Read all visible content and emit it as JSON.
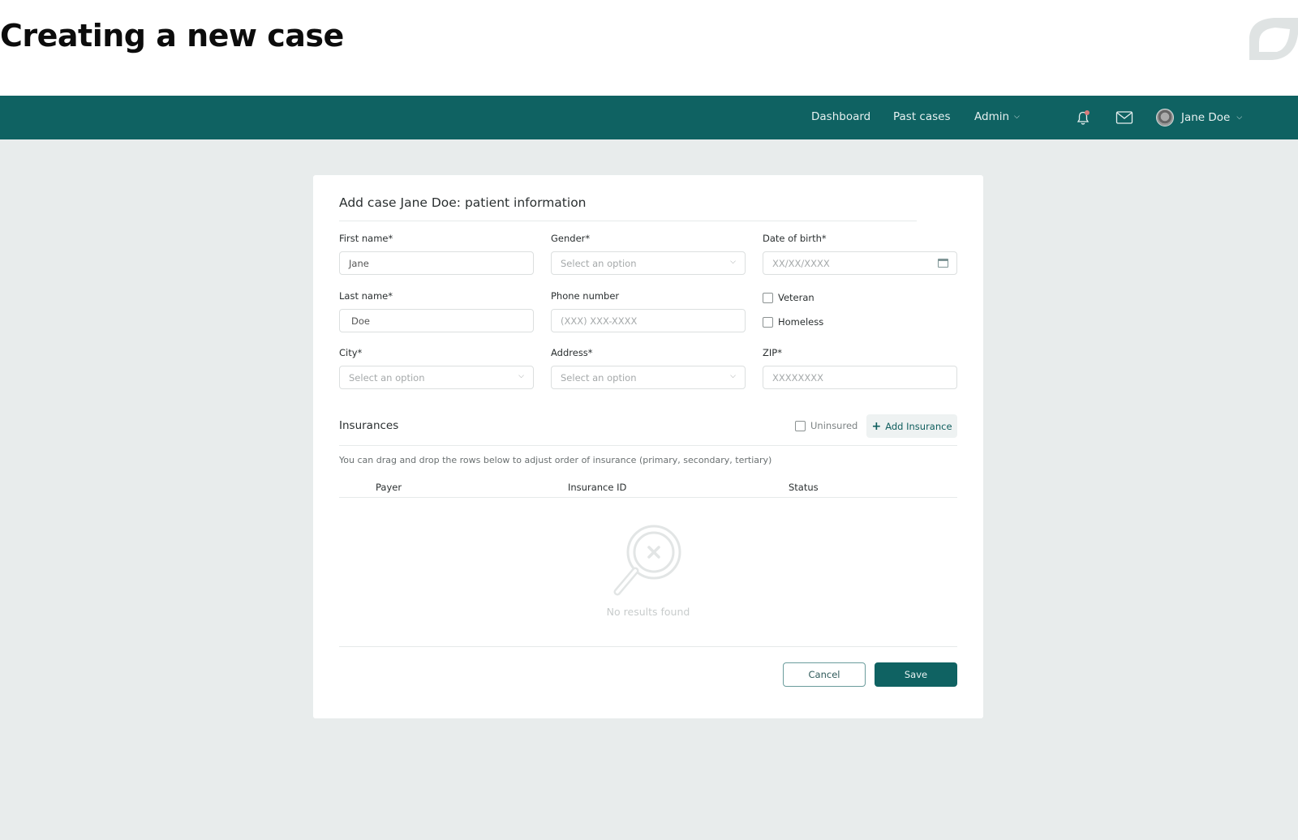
{
  "page": {
    "title": "Creating a new case"
  },
  "navbar": {
    "links": [
      {
        "label": "Dashboard"
      },
      {
        "label": "Past cases"
      },
      {
        "label": "Admin",
        "has_dropdown": true
      }
    ],
    "icons": {
      "notifications": "bell-icon",
      "messages": "mail-icon"
    },
    "user": {
      "name": "Jane Doe",
      "has_dropdown": true
    },
    "colors": {
      "bar": "#0f6262",
      "notification_dot": "#d97c7c"
    }
  },
  "form": {
    "title": "Add case Jane Doe: patient information",
    "fields": {
      "first_name": {
        "label": "First name*",
        "value": "Jane"
      },
      "gender": {
        "label": "Gender*",
        "placeholder": "Select an option"
      },
      "dob": {
        "label": "Date of birth*",
        "placeholder": "XX/XX/XXXX"
      },
      "last_name": {
        "label": "Last name*",
        "value": "Doe"
      },
      "phone": {
        "label": "Phone number",
        "placeholder": "(XXX) XXX-XXXX"
      },
      "city": {
        "label": "City*",
        "placeholder": "Select an option"
      },
      "address": {
        "label": "Address*",
        "placeholder": "Select an option"
      },
      "zip": {
        "label": "ZIP*",
        "placeholder": "XXXXXXXX"
      }
    },
    "checkboxes": {
      "veteran": {
        "label": "Veteran",
        "checked": false
      },
      "homeless": {
        "label": "Homeless",
        "checked": false
      }
    }
  },
  "insurances": {
    "title": "Insurances",
    "uninsured": {
      "label": "Uninsured",
      "checked": false
    },
    "add_button": "Add Insurance",
    "hint": "You can drag and drop the rows below to adjust order of insurance (primary, secondary, tertiary)",
    "columns": [
      "Payer",
      "Insurance ID",
      "Status"
    ],
    "rows": [],
    "empty_text": "No results found"
  },
  "actions": {
    "cancel": "Cancel",
    "save": "Save"
  }
}
